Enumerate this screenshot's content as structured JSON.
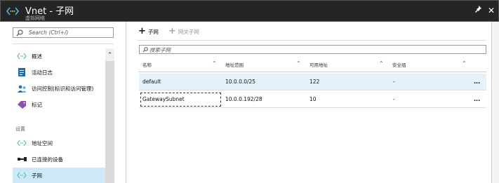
{
  "window": {
    "title": "Vnet - 子网",
    "subtitle": "虚拟网络"
  },
  "sidebar": {
    "search_placeholder": "Search (Ctrl+/)",
    "items": [
      {
        "label": "概述",
        "icon": "network-icon"
      },
      {
        "label": "活动日志",
        "icon": "activity-log-icon"
      },
      {
        "label": "访问控制(标识和访问管理)",
        "icon": "iam-icon"
      },
      {
        "label": "标记",
        "icon": "tag-icon"
      }
    ],
    "section": "设置",
    "settings_items": [
      {
        "label": "地址空间",
        "icon": "network-icon"
      },
      {
        "label": "已连接的设备",
        "icon": "device-icon"
      },
      {
        "label": "子网",
        "icon": "network-icon",
        "active": true
      }
    ]
  },
  "toolbar": {
    "add_subnet": "子网",
    "add_gateway_subnet": "网关子网"
  },
  "filter": {
    "placeholder": "搜索子网"
  },
  "table": {
    "columns": [
      "名称",
      "地址范围",
      "可用地址",
      "安全组"
    ],
    "rows": [
      {
        "name": "default",
        "range": "10.0.0.0/25",
        "available": "122",
        "nsg": "-"
      },
      {
        "name": "GatewaySubnet",
        "range": "10.0.0.192/28",
        "available": "10",
        "nsg": "-"
      }
    ],
    "more_label": "..."
  },
  "colors": {
    "titlebar": "#252526",
    "selected_row": "#e4f2fb",
    "active_nav": "#cde8f6",
    "accent": "#0072c6"
  }
}
